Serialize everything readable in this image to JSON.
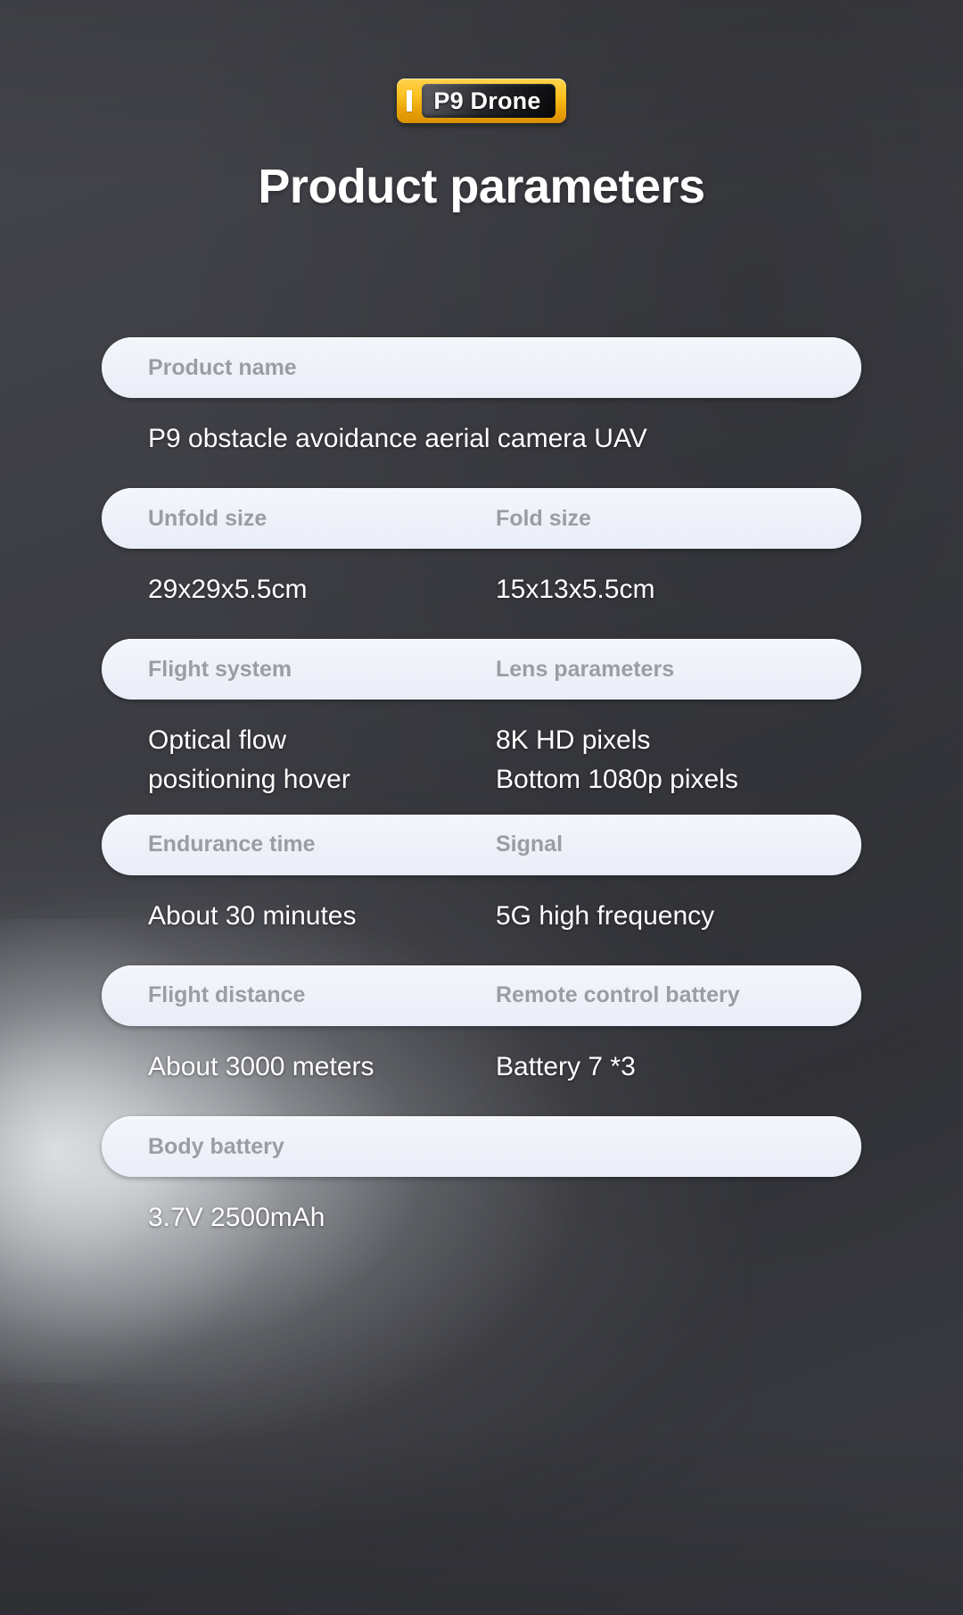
{
  "badge": {
    "tick_icon": "vertical-bar-icon",
    "text": "P9 Drone"
  },
  "title": "Product parameters",
  "colors": {
    "background": "#3e3f45",
    "pill_fill": "#eef1f9",
    "pill_label": "#9b9da5",
    "value_text": "#ffffff",
    "badge_gold": "#fcc01f",
    "badge_inner": "#121315"
  },
  "spec_blocks": [
    {
      "labels": [
        "Product name"
      ],
      "values": [
        "P9 obstacle avoidance aerial camera UAV"
      ],
      "columns": 1
    },
    {
      "labels": [
        "Unfold size",
        "Fold size"
      ],
      "values": [
        "29x29x5.5cm",
        "15x13x5.5cm"
      ],
      "columns": 2
    },
    {
      "labels": [
        "Flight system",
        "Lens parameters"
      ],
      "values": [
        "Optical flow\npositioning hover",
        "8K HD pixels\nBottom 1080p pixels"
      ],
      "columns": 2
    },
    {
      "labels": [
        "Endurance time",
        "Signal"
      ],
      "values": [
        "About 30 minutes",
        "5G high frequency"
      ],
      "columns": 2
    },
    {
      "labels": [
        "Flight distance",
        "Remote control battery"
      ],
      "values": [
        "About 3000 meters",
        "Battery 7 *3"
      ],
      "columns": 2
    },
    {
      "labels": [
        "Body battery"
      ],
      "values": [
        "3.7V 2500mAh"
      ],
      "columns": 1
    }
  ]
}
